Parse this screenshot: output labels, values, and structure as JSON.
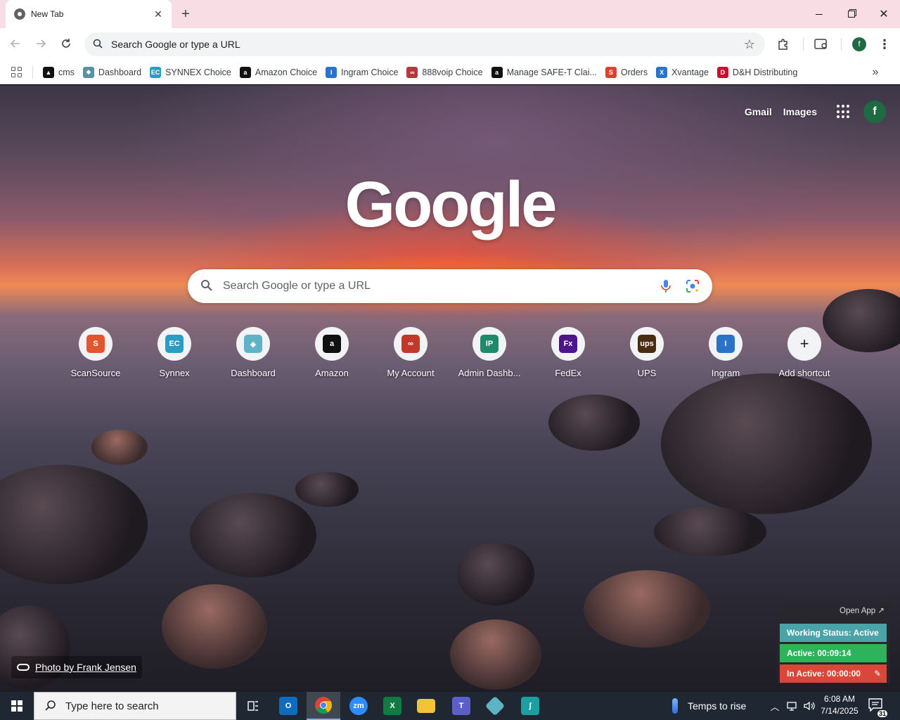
{
  "window": {
    "tab_title": "New Tab",
    "tab_close": "✕",
    "new_tab": "+",
    "close_symbol": "✕"
  },
  "toolbar": {
    "address_placeholder": "Search Google or type a URL",
    "profile_initial": "f"
  },
  "bookmarks": [
    {
      "label": "cms",
      "icon": "cms-icon",
      "color": "#111111",
      "glyph": "▲"
    },
    {
      "label": "Dashboard",
      "icon": "dashboard-icon",
      "color": "#5a8fa8",
      "glyph": "◆"
    },
    {
      "label": "SYNNEX Choice",
      "icon": "synnex-icon",
      "color": "#2a9ec2",
      "glyph": "EC"
    },
    {
      "label": "Amazon Choice",
      "icon": "amazon-icon",
      "color": "#111111",
      "glyph": "a"
    },
    {
      "label": "Ingram Choice",
      "icon": "ingram-icon",
      "color": "#2b72c9",
      "glyph": "I"
    },
    {
      "label": "888voip Choice",
      "icon": "voip-icon",
      "color": "#b23a3a",
      "glyph": "∞"
    },
    {
      "label": "Manage SAFE-T Clai...",
      "icon": "amazon-icon",
      "color": "#111111",
      "glyph": "a"
    },
    {
      "label": "Orders",
      "icon": "orders-icon",
      "color": "#d8452f",
      "glyph": "S"
    },
    {
      "label": "Xvantage",
      "icon": "xvantage-icon",
      "color": "#2b72c9",
      "glyph": "X"
    },
    {
      "label": "D&H Distributing",
      "icon": "dh-icon",
      "color": "#c8102e",
      "glyph": "D"
    }
  ],
  "ntp": {
    "gmail": "Gmail",
    "images": "Images",
    "avatar_initial": "f",
    "logo": "Google",
    "search_placeholder": "Search Google or type a URL",
    "shortcuts": [
      {
        "label": "ScanSource",
        "icon": "scansource-icon",
        "color": "#e2562f",
        "glyph": "S"
      },
      {
        "label": "Synnex",
        "icon": "synnex-icon",
        "color": "#2a9ec2",
        "glyph": "EC"
      },
      {
        "label": "Dashboard",
        "icon": "dashboard-icon",
        "color": "#5fb3c7",
        "glyph": "◆"
      },
      {
        "label": "Amazon",
        "icon": "amazon-icon",
        "color": "#111111",
        "glyph": "a"
      },
      {
        "label": "My Account",
        "icon": "account-icon",
        "color": "#c0392b",
        "glyph": "∞"
      },
      {
        "label": "Admin Dashb...",
        "icon": "admin-icon",
        "color": "#1f8a6b",
        "glyph": "IP"
      },
      {
        "label": "FedEx",
        "icon": "fedex-icon",
        "color": "#4d148c",
        "glyph": "Fx"
      },
      {
        "label": "UPS",
        "icon": "ups-icon",
        "color": "#4a2c12",
        "glyph": "ups"
      },
      {
        "label": "Ingram",
        "icon": "ingram-icon",
        "color": "#2b72c9",
        "glyph": "I"
      },
      {
        "label": "Add shortcut",
        "icon": "plus-icon",
        "color": "#f1f3f4",
        "glyph": "+"
      }
    ],
    "photo_credit": "Photo by Frank Jensen"
  },
  "tracker": {
    "open_app": "Open App ↗",
    "status": "Working Status: Active",
    "active": "Active: 00:09:14",
    "inactive": "In Active: 00:00:00"
  },
  "taskbar": {
    "search_placeholder": "Type here to search",
    "weather": "Temps to rise",
    "time": "6:08 AM",
    "date": "7/14/2025",
    "notifications": "31"
  }
}
